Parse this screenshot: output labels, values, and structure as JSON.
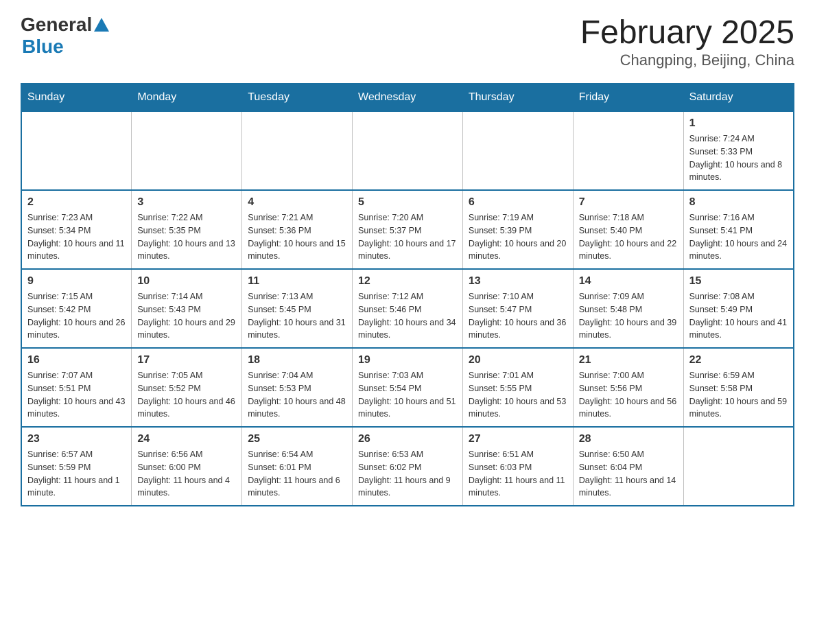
{
  "header": {
    "logo_text_general": "General",
    "logo_text_blue": "Blue",
    "title": "February 2025",
    "subtitle": "Changping, Beijing, China"
  },
  "weekdays": [
    "Sunday",
    "Monday",
    "Tuesday",
    "Wednesday",
    "Thursday",
    "Friday",
    "Saturday"
  ],
  "weeks": [
    [
      {
        "day": "",
        "info": ""
      },
      {
        "day": "",
        "info": ""
      },
      {
        "day": "",
        "info": ""
      },
      {
        "day": "",
        "info": ""
      },
      {
        "day": "",
        "info": ""
      },
      {
        "day": "",
        "info": ""
      },
      {
        "day": "1",
        "info": "Sunrise: 7:24 AM\nSunset: 5:33 PM\nDaylight: 10 hours and 8 minutes."
      }
    ],
    [
      {
        "day": "2",
        "info": "Sunrise: 7:23 AM\nSunset: 5:34 PM\nDaylight: 10 hours and 11 minutes."
      },
      {
        "day": "3",
        "info": "Sunrise: 7:22 AM\nSunset: 5:35 PM\nDaylight: 10 hours and 13 minutes."
      },
      {
        "day": "4",
        "info": "Sunrise: 7:21 AM\nSunset: 5:36 PM\nDaylight: 10 hours and 15 minutes."
      },
      {
        "day": "5",
        "info": "Sunrise: 7:20 AM\nSunset: 5:37 PM\nDaylight: 10 hours and 17 minutes."
      },
      {
        "day": "6",
        "info": "Sunrise: 7:19 AM\nSunset: 5:39 PM\nDaylight: 10 hours and 20 minutes."
      },
      {
        "day": "7",
        "info": "Sunrise: 7:18 AM\nSunset: 5:40 PM\nDaylight: 10 hours and 22 minutes."
      },
      {
        "day": "8",
        "info": "Sunrise: 7:16 AM\nSunset: 5:41 PM\nDaylight: 10 hours and 24 minutes."
      }
    ],
    [
      {
        "day": "9",
        "info": "Sunrise: 7:15 AM\nSunset: 5:42 PM\nDaylight: 10 hours and 26 minutes."
      },
      {
        "day": "10",
        "info": "Sunrise: 7:14 AM\nSunset: 5:43 PM\nDaylight: 10 hours and 29 minutes."
      },
      {
        "day": "11",
        "info": "Sunrise: 7:13 AM\nSunset: 5:45 PM\nDaylight: 10 hours and 31 minutes."
      },
      {
        "day": "12",
        "info": "Sunrise: 7:12 AM\nSunset: 5:46 PM\nDaylight: 10 hours and 34 minutes."
      },
      {
        "day": "13",
        "info": "Sunrise: 7:10 AM\nSunset: 5:47 PM\nDaylight: 10 hours and 36 minutes."
      },
      {
        "day": "14",
        "info": "Sunrise: 7:09 AM\nSunset: 5:48 PM\nDaylight: 10 hours and 39 minutes."
      },
      {
        "day": "15",
        "info": "Sunrise: 7:08 AM\nSunset: 5:49 PM\nDaylight: 10 hours and 41 minutes."
      }
    ],
    [
      {
        "day": "16",
        "info": "Sunrise: 7:07 AM\nSunset: 5:51 PM\nDaylight: 10 hours and 43 minutes."
      },
      {
        "day": "17",
        "info": "Sunrise: 7:05 AM\nSunset: 5:52 PM\nDaylight: 10 hours and 46 minutes."
      },
      {
        "day": "18",
        "info": "Sunrise: 7:04 AM\nSunset: 5:53 PM\nDaylight: 10 hours and 48 minutes."
      },
      {
        "day": "19",
        "info": "Sunrise: 7:03 AM\nSunset: 5:54 PM\nDaylight: 10 hours and 51 minutes."
      },
      {
        "day": "20",
        "info": "Sunrise: 7:01 AM\nSunset: 5:55 PM\nDaylight: 10 hours and 53 minutes."
      },
      {
        "day": "21",
        "info": "Sunrise: 7:00 AM\nSunset: 5:56 PM\nDaylight: 10 hours and 56 minutes."
      },
      {
        "day": "22",
        "info": "Sunrise: 6:59 AM\nSunset: 5:58 PM\nDaylight: 10 hours and 59 minutes."
      }
    ],
    [
      {
        "day": "23",
        "info": "Sunrise: 6:57 AM\nSunset: 5:59 PM\nDaylight: 11 hours and 1 minute."
      },
      {
        "day": "24",
        "info": "Sunrise: 6:56 AM\nSunset: 6:00 PM\nDaylight: 11 hours and 4 minutes."
      },
      {
        "day": "25",
        "info": "Sunrise: 6:54 AM\nSunset: 6:01 PM\nDaylight: 11 hours and 6 minutes."
      },
      {
        "day": "26",
        "info": "Sunrise: 6:53 AM\nSunset: 6:02 PM\nDaylight: 11 hours and 9 minutes."
      },
      {
        "day": "27",
        "info": "Sunrise: 6:51 AM\nSunset: 6:03 PM\nDaylight: 11 hours and 11 minutes."
      },
      {
        "day": "28",
        "info": "Sunrise: 6:50 AM\nSunset: 6:04 PM\nDaylight: 11 hours and 14 minutes."
      },
      {
        "day": "",
        "info": ""
      }
    ]
  ]
}
